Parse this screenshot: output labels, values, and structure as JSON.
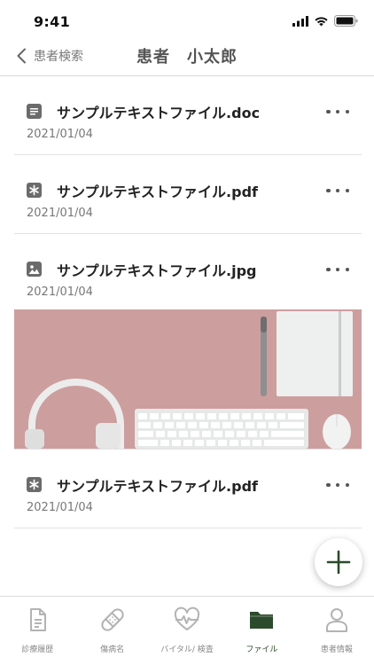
{
  "status_bar": {
    "time": "9:41"
  },
  "nav": {
    "back_label": "患者検索",
    "title": "患者　小太郎"
  },
  "files": [
    {
      "name": "サンプルテキストファイル.doc",
      "date": "2021/01/04",
      "type": "doc"
    },
    {
      "name": "サンプルテキストファイル.pdf",
      "date": "2021/01/04",
      "type": "pdf"
    },
    {
      "name": "サンプルテキストファイル.jpg",
      "date": "2021/01/04",
      "type": "image"
    },
    {
      "name": "サンプルテキストファイル.pdf",
      "date": "2021/01/04",
      "type": "pdf"
    }
  ],
  "tabs": [
    {
      "label": "診療履歴",
      "icon": "document-icon",
      "active": false
    },
    {
      "label": "傷病名",
      "icon": "bandage-icon",
      "active": false
    },
    {
      "label": "バイタル/ 検査",
      "icon": "heart-pulse-icon",
      "active": false
    },
    {
      "label": "ファイル",
      "icon": "folder-icon",
      "active": true
    },
    {
      "label": "患者情報",
      "icon": "person-icon",
      "active": false
    }
  ],
  "colors": {
    "accent": "#2c4a2c",
    "icon_gray": "#6b6b6b",
    "inactive": "#b0b0b0"
  }
}
